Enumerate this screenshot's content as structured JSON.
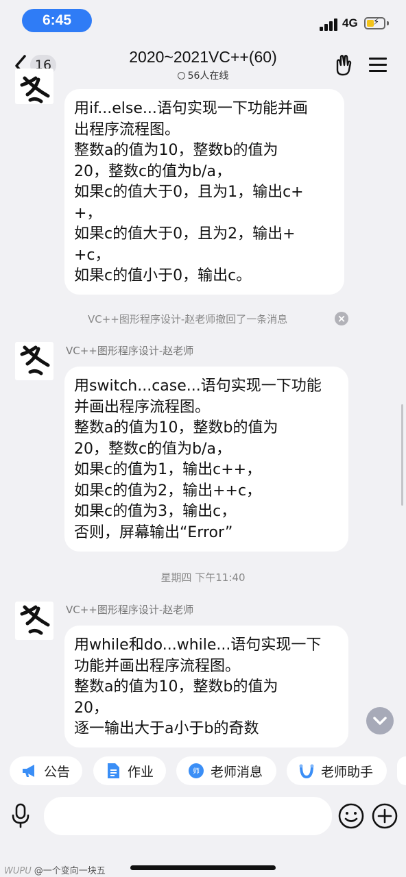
{
  "status_bar": {
    "time": "6:45",
    "network": "4G"
  },
  "header": {
    "unread_count": "16",
    "title": "2020~2021VC++(60)",
    "online": "56人在线"
  },
  "messages": [
    {
      "text": "用if...else...语句实现一下功能并画\n出程序流程图。\n整数a的值为10，整数b的值为\n20，整数c的值为b/a，\n如果c的值大于0，且为1，输出c+\n+，\n如果c的值大于0，且为2，输出+\n+c，\n如果c的值小于0，输出c。"
    },
    {
      "sender": "VC++图形程序设计-赵老师",
      "text": "用switch...case...语句实现一下功能\n并画出程序流程图。\n整数a的值为10，整数b的值为\n20，整数c的值为b/a，\n如果c的值为1，输出c++，\n如果c的值为2，输出++c，\n如果c的值为3，输出c，\n否则，屏幕输出“Error”"
    },
    {
      "sender": "VC++图形程序设计-赵老师",
      "text": "用while和do...while...语句实现一下\n功能并画出程序流程图。\n整数a的值为10，整数b的值为\n20，\n逐一输出大于a小于b的奇数"
    }
  ],
  "recall_notice": "VC++图形程序设计-赵老师撤回了一条消息",
  "timestamp": "星期四 下午11:40",
  "quick_tabs": [
    {
      "label": "公告",
      "icon": "megaphone-icon",
      "color": "#3a8ef6"
    },
    {
      "label": "作业",
      "icon": "document-icon",
      "color": "#3a8ef6"
    },
    {
      "label": "老师消息",
      "icon": "teacher-message-icon",
      "color": "#3a8ef6"
    },
    {
      "label": "老师助手",
      "icon": "assistant-icon",
      "color": "#3a8ef6"
    }
  ],
  "input": {
    "placeholder": ""
  },
  "watermark": {
    "brand": "WUPU",
    "text": "@一个变向一块五"
  },
  "colors": {
    "accent": "#2f7cf6",
    "background": "#f1f1f4",
    "bubble": "#ffffff"
  }
}
